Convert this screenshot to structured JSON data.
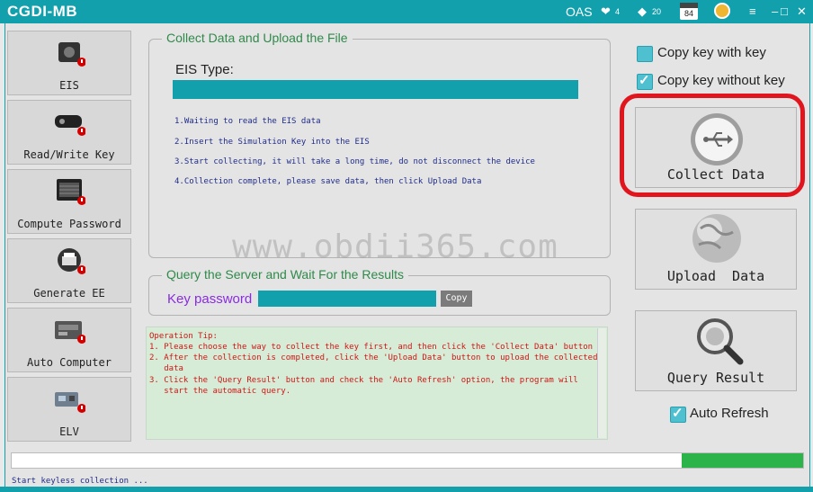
{
  "window": {
    "title": "CGDI-MB",
    "oas": "OAS",
    "hearts": "4",
    "gems": "20",
    "calendar": "84",
    "controls": [
      "≡",
      "‒",
      "□",
      "✕"
    ]
  },
  "sidebar": [
    {
      "label": "EIS",
      "icon": "ignition-switch-icon"
    },
    {
      "label": "Read/Write Key",
      "icon": "car-key-icon"
    },
    {
      "label": "Compute Password",
      "icon": "keyboard-icon"
    },
    {
      "label": "Generate EE",
      "icon": "printer-icon"
    },
    {
      "label": "Auto Computer",
      "icon": "ecu-icon"
    },
    {
      "label": "ELV",
      "icon": "elv-module-icon"
    }
  ],
  "collect_group": {
    "title": "Collect Data and Upload the File",
    "eis_type_label": "EIS Type:",
    "steps": [
      "1.Waiting to read the EIS data",
      "2.Insert the Simulation Key into the EIS",
      "3.Start collecting, it will take a long time, do not disconnect the device",
      "4.Collection complete, please save data, then click Upload Data"
    ]
  },
  "watermark": "www.obdii365.com",
  "query_group": {
    "title": "Query the Server and Wait For the Results",
    "key_label": "Key password",
    "copy_label": "Copy"
  },
  "tip_lines": [
    "Operation Tip:",
    "1. Please choose the way to collect the key first, and then click the 'Collect Data' button",
    "2. After the collection is completed, click the 'Upload Data' button to upload the collected",
    "   data",
    "3. Click the 'Query Result' button and check the 'Auto Refresh' option, the program will",
    "   start the automatic query."
  ],
  "options": {
    "copy_with_key": "Copy key with key",
    "copy_without_key": "Copy key without key",
    "auto_refresh": "Auto Refresh"
  },
  "buttons": {
    "collect": "Collect Data",
    "upload": "Upload  Data",
    "query": "Query Result"
  },
  "status": "Start keyless collection ...",
  "colors": {
    "accent": "#12a0ad",
    "highlight": "#e0151d",
    "progress": "#2cb34a"
  }
}
